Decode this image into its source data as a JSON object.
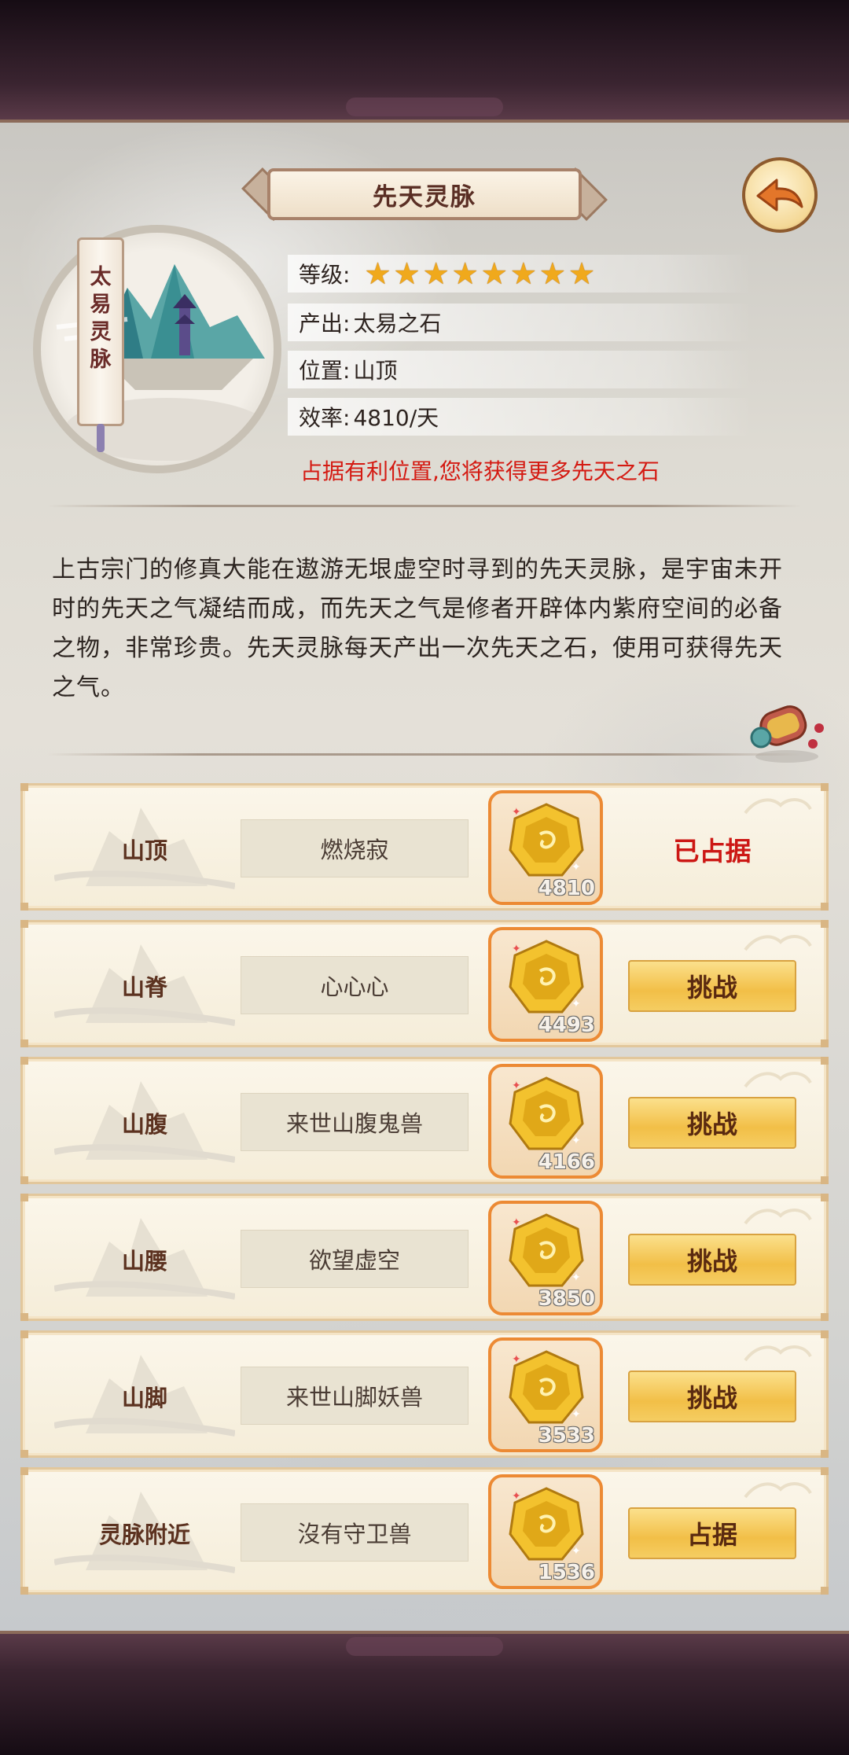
{
  "header": {
    "title": "先天灵脉",
    "back_icon": "back-arrow-icon"
  },
  "vein": {
    "portrait_label": [
      "太",
      "易",
      "灵",
      "脉"
    ],
    "level_label": "等级:",
    "level_stars": 8,
    "output_label": "产出:",
    "output_value": "太易之石",
    "position_label": "位置:",
    "position_value": "山顶",
    "efficiency_label": "效率:",
    "efficiency_value": "4810/天",
    "notice": "占据有利位置,您将获得更多先天之石"
  },
  "description": "上古宗门的修真大能在遨游无垠虚空时寻到的先天灵脉，是宇宙未开时的先天之气凝结而成，而先天之气是修者开辟体内紫府空间的必备之物，非常珍贵。先天灵脉每天产出一次先天之石，使用可获得先天之气。",
  "slots": [
    {
      "position": "山顶",
      "guardian": "燃烧寂",
      "reward": "4810",
      "action": "已占据",
      "occupied": true
    },
    {
      "position": "山脊",
      "guardian": "心心心",
      "reward": "4493",
      "action": "挑战",
      "occupied": false
    },
    {
      "position": "山腹",
      "guardian": "来世山腹鬼兽",
      "reward": "4166",
      "action": "挑战",
      "occupied": false
    },
    {
      "position": "山腰",
      "guardian": "欲望虚空",
      "reward": "3850",
      "action": "挑战",
      "occupied": false
    },
    {
      "position": "山脚",
      "guardian": "来世山脚妖兽",
      "reward": "3533",
      "action": "挑战",
      "occupied": false
    },
    {
      "position": "灵脉附近",
      "guardian": "沒有守卫兽",
      "reward": "1536",
      "action": "占据",
      "occupied": false
    }
  ],
  "colors": {
    "notice": "#d41a12",
    "occupied": "#cc1714",
    "button_gold": "#f2bf47",
    "gem_border": "#ec8a34",
    "star": "#f0a91c"
  }
}
